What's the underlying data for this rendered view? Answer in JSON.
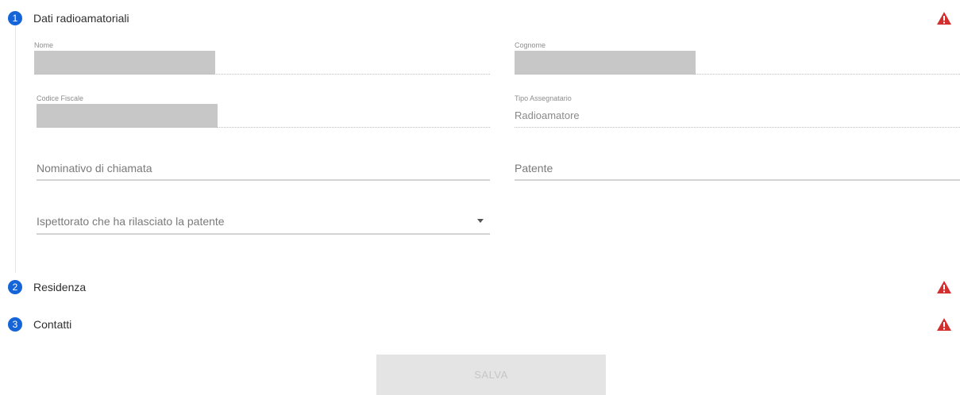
{
  "steps": [
    {
      "number": "1",
      "title": "Dati radioamatoriali",
      "status_icon": "warning-triangle-icon"
    },
    {
      "number": "2",
      "title": "Residenza",
      "status_icon": "warning-triangle-icon"
    },
    {
      "number": "3",
      "title": "Contatti",
      "status_icon": "warning-triangle-icon"
    }
  ],
  "form": {
    "nome": {
      "label": "Nome",
      "value": ""
    },
    "cognome": {
      "label": "Cognome",
      "value": ""
    },
    "codice_fiscale": {
      "label": "Codice Fiscale",
      "value": ""
    },
    "tipo_assegnatario": {
      "label": "Tipo Assegnatario",
      "value": "Radioamatore"
    },
    "nominativo": {
      "placeholder": "Nominativo di chiamata"
    },
    "patente": {
      "placeholder": "Patente"
    },
    "ispettorato": {
      "placeholder": "Ispettorato che ha rilasciato la patente"
    }
  },
  "actions": {
    "save_label": "SALVA"
  },
  "colors": {
    "step_blue": "#1565d8",
    "warning_red": "#d32f2f",
    "button_disabled": "#e4e4e4"
  }
}
